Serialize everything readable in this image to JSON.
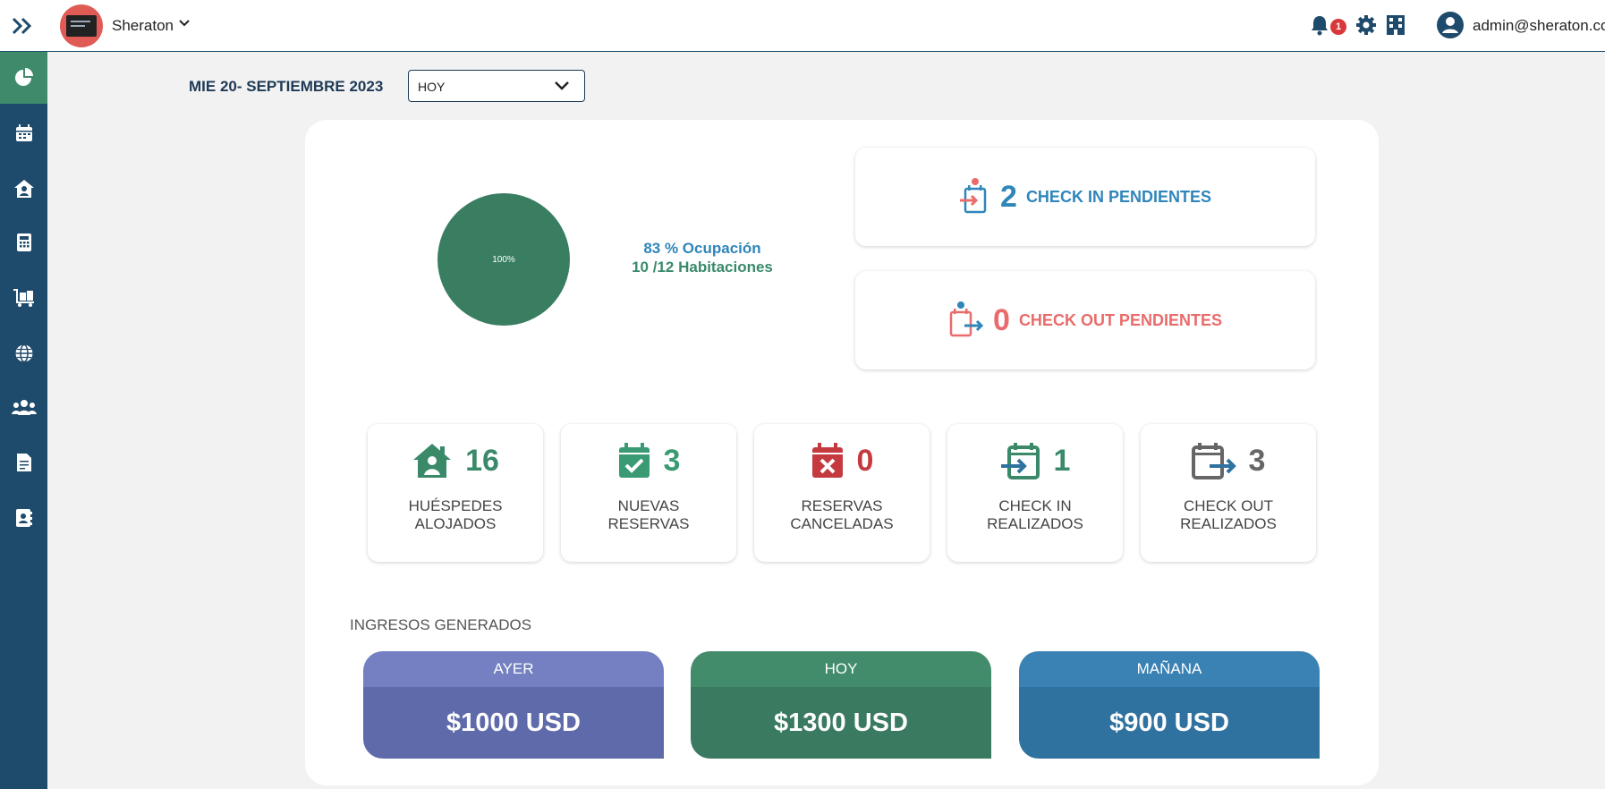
{
  "header": {
    "hotel_name": "Sheraton",
    "notifications_count": "1",
    "user_email": "admin@sheraton.com"
  },
  "sidebar": {
    "items": [
      {
        "icon": "chart-pie-icon",
        "active": true
      },
      {
        "icon": "calendar-icon"
      },
      {
        "icon": "guest-home-icon"
      },
      {
        "icon": "calculator-icon"
      },
      {
        "icon": "luggage-cart-icon"
      },
      {
        "icon": "globe-icon"
      },
      {
        "icon": "users-icon"
      },
      {
        "icon": "document-icon"
      },
      {
        "icon": "contact-book-icon"
      }
    ]
  },
  "toolbar": {
    "date": "MIE 20- SEPTIEMBRE 2023",
    "period": "HOY"
  },
  "occupancy": {
    "pie_value_percent": 100,
    "pie_label": "100%",
    "occupancy_text": "83 % Ocupación",
    "rooms_text": "10 /12 Habitaciones"
  },
  "pending": {
    "checkin": {
      "count": "2",
      "label": "CHECK IN PENDIENTES",
      "color": "#2f86b9"
    },
    "checkout": {
      "count": "0",
      "label": "CHECK OUT PENDIENTES",
      "color": "#ea6b6b"
    }
  },
  "stats": [
    {
      "value": "16",
      "line1": "HUÉSPEDES",
      "line2": "ALOJADOS",
      "color": "#3a8a6a",
      "icon": "guest-home-icon"
    },
    {
      "value": "3",
      "line1": "NUEVAS",
      "line2": "RESERVAS",
      "color": "#3a9a73",
      "icon": "calendar-check-icon"
    },
    {
      "value": "0",
      "line1": "RESERVAS",
      "line2": "CANCELADAS",
      "color": "#c43a3f",
      "icon": "calendar-cancel-icon"
    },
    {
      "value": "1",
      "line1": "CHECK IN",
      "line2": "REALIZADOS",
      "color": "#3a8a6a",
      "icon": "calendar-checkin-icon"
    },
    {
      "value": "3",
      "line1": "CHECK OUT",
      "line2": "REALIZADOS",
      "color": "#666666",
      "icon": "calendar-checkout-icon"
    }
  ],
  "income": {
    "title": "INGRESOS GENERADOS",
    "cards": [
      {
        "label": "AYER",
        "amount": "$1000 USD",
        "head_color": "#7480c1",
        "body_color": "#5e6aaa"
      },
      {
        "label": "HOY",
        "amount": "$1300 USD",
        "head_color": "#428c6c",
        "body_color": "#3a7a60"
      },
      {
        "label": "MAÑANA",
        "amount": "$900 USD",
        "head_color": "#3a82b3",
        "body_color": "#2f72a0"
      }
    ]
  }
}
